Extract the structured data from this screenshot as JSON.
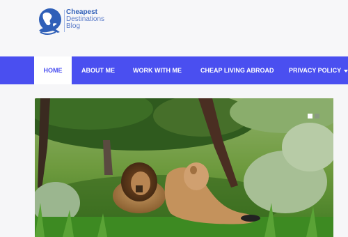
{
  "logo": {
    "line1": "Cheapest",
    "line2": "Destinations",
    "line3": "Blog",
    "icon": "globe-plane-icon",
    "color": "#2f5fb8"
  },
  "nav": {
    "accent": "#4a4ff0",
    "items": [
      {
        "label": "HOME",
        "active": true
      },
      {
        "label": "ABOUT ME"
      },
      {
        "label": "WORK WITH ME"
      },
      {
        "label": "CHEAP LIVING ABROAD"
      },
      {
        "label": "PRIVACY POLICY",
        "dropdown": true
      }
    ]
  },
  "hero": {
    "image": "lions-resting-under-tree",
    "slides_visible": 2
  }
}
